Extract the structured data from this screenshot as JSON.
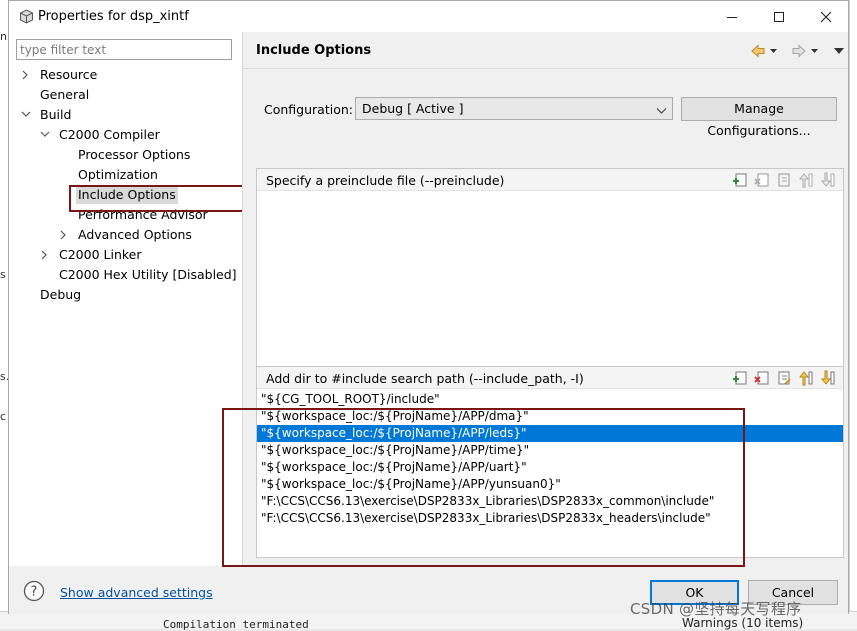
{
  "window": {
    "title": "Properties for dsp_xintf"
  },
  "background": {
    "console_text": "Compilation terminated",
    "right_text": "Warnings (10 items)",
    "edge_glyphs": [
      "n",
      "s",
      "s.",
      "c"
    ]
  },
  "filter": {
    "placeholder": "type filter text",
    "value": ""
  },
  "tree": [
    {
      "label": "Resource"
    },
    {
      "label": "General"
    },
    {
      "label": "Build"
    },
    {
      "label": "C2000 Compiler"
    },
    {
      "label": "Processor Options"
    },
    {
      "label": "Optimization"
    },
    {
      "label": "Include Options"
    },
    {
      "label": "Performance Advisor"
    },
    {
      "label": "Advanced Options"
    },
    {
      "label": "C2000 Linker"
    },
    {
      "label": "C2000 Hex Utility  [Disabled]"
    },
    {
      "label": "Debug"
    }
  ],
  "page": {
    "title": "Include Options"
  },
  "configuration": {
    "label": "Configuration:",
    "value": "Debug  [ Active ]",
    "manage_label": "Manage Configurations..."
  },
  "preinclude": {
    "title": "Specify a preinclude file (--preinclude)",
    "items": []
  },
  "include_path": {
    "title": "Add dir to #include search path (--include_path, -I)",
    "items": [
      "\"${CG_TOOL_ROOT}/include\"",
      "\"${workspace_loc:/${ProjName}/APP/dma}\"",
      "\"${workspace_loc:/${ProjName}/APP/leds}\"",
      "\"${workspace_loc:/${ProjName}/APP/time}\"",
      "\"${workspace_loc:/${ProjName}/APP/uart}\"",
      "\"${workspace_loc:/${ProjName}/APP/yunsuan0}\"",
      "\"F:\\CCS\\CCS6.13\\exercise\\DSP2833x_Libraries\\DSP2833x_common\\include\"",
      "\"F:\\CCS\\CCS6.13\\exercise\\DSP2833x_Libraries\\DSP2833x_headers\\include\""
    ],
    "selected_index": 2
  },
  "footer": {
    "advanced_link": "Show advanced settings",
    "ok_label": "OK",
    "cancel_label": "Cancel"
  },
  "watermark": "CSDN @坚持每天写程序",
  "colors": {
    "selection": "#0078d7",
    "annotation_box": "#7b1616",
    "link": "#0052a3"
  }
}
